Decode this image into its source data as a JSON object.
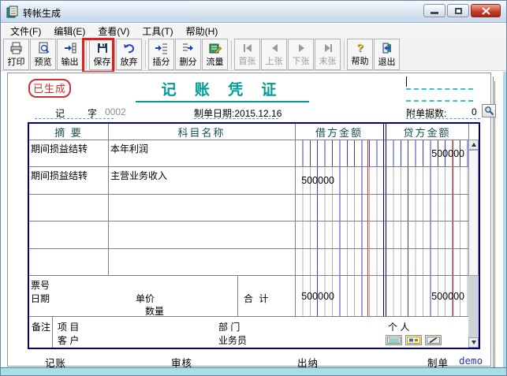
{
  "window": {
    "title": "转帐生成"
  },
  "menu": {
    "items": [
      {
        "label": "文件(F)"
      },
      {
        "label": "编辑(E)"
      },
      {
        "label": "查看(V)"
      },
      {
        "label": "工具(T)"
      },
      {
        "label": "帮助(H)"
      }
    ]
  },
  "toolbar": {
    "buttons": [
      {
        "label": "打印"
      },
      {
        "label": "预览"
      },
      {
        "label": "输出"
      },
      {
        "label": "保存"
      },
      {
        "label": "放弃"
      },
      {
        "label": "插分"
      },
      {
        "label": "删分"
      },
      {
        "label": "流量"
      },
      {
        "label": "首张"
      },
      {
        "label": "上张"
      },
      {
        "label": "下张"
      },
      {
        "label": "末张"
      },
      {
        "label": "帮助"
      },
      {
        "label": "退出"
      }
    ],
    "highlighted_button": "保存"
  },
  "voucher": {
    "stamp": "已生成",
    "title": "记 账 凭 证",
    "word": {
      "label1": "记",
      "label2": "字",
      "number": "0002"
    },
    "date": {
      "label": "制单日期:",
      "value": "2015.12.16"
    },
    "attachments": {
      "label": "附单据数:",
      "value": "0"
    },
    "table": {
      "headers": {
        "summary": "摘 要",
        "account": "科目名称",
        "debit": "借方金额",
        "credit": "贷方金额"
      },
      "rows": [
        {
          "summary": "期间损益结转",
          "account": "本年利润",
          "debit": "",
          "credit": "500000"
        },
        {
          "summary": "期间损益结转",
          "account": "主营业务收入",
          "debit": "500000",
          "credit": ""
        },
        {
          "summary": "",
          "account": "",
          "debit": "",
          "credit": ""
        },
        {
          "summary": "",
          "account": "",
          "debit": "",
          "credit": ""
        },
        {
          "summary": "",
          "account": "",
          "debit": "",
          "credit": ""
        }
      ],
      "footer": {
        "ticket_label": "票号",
        "date_label": "日期",
        "unit_price_label": "单价",
        "quantity_label": "数量",
        "total_label": "合 计",
        "total_debit": "500000",
        "total_credit": "500000"
      },
      "remark": {
        "label": "备注",
        "project_label": "项 目",
        "customer_label": "客 户",
        "department_label": "部 门",
        "salesman_label": "业务员",
        "person_label": "个 人"
      }
    },
    "signatures": {
      "bookkeeping_label": "记账",
      "review_label": "审核",
      "cashier_label": "出纳",
      "preparer_label": "制单",
      "preparer_name": "demo"
    }
  },
  "colors": {
    "title_teal": "#009b9b",
    "stamp_red": "#d03030",
    "highlight_red": "#e02020",
    "table_border_navy": "#000080",
    "grid_blue": "#3c3cc0",
    "grid_red": "#c03030",
    "client_cyan": "#a9dde8",
    "preparer_blue": "#2233bb"
  }
}
